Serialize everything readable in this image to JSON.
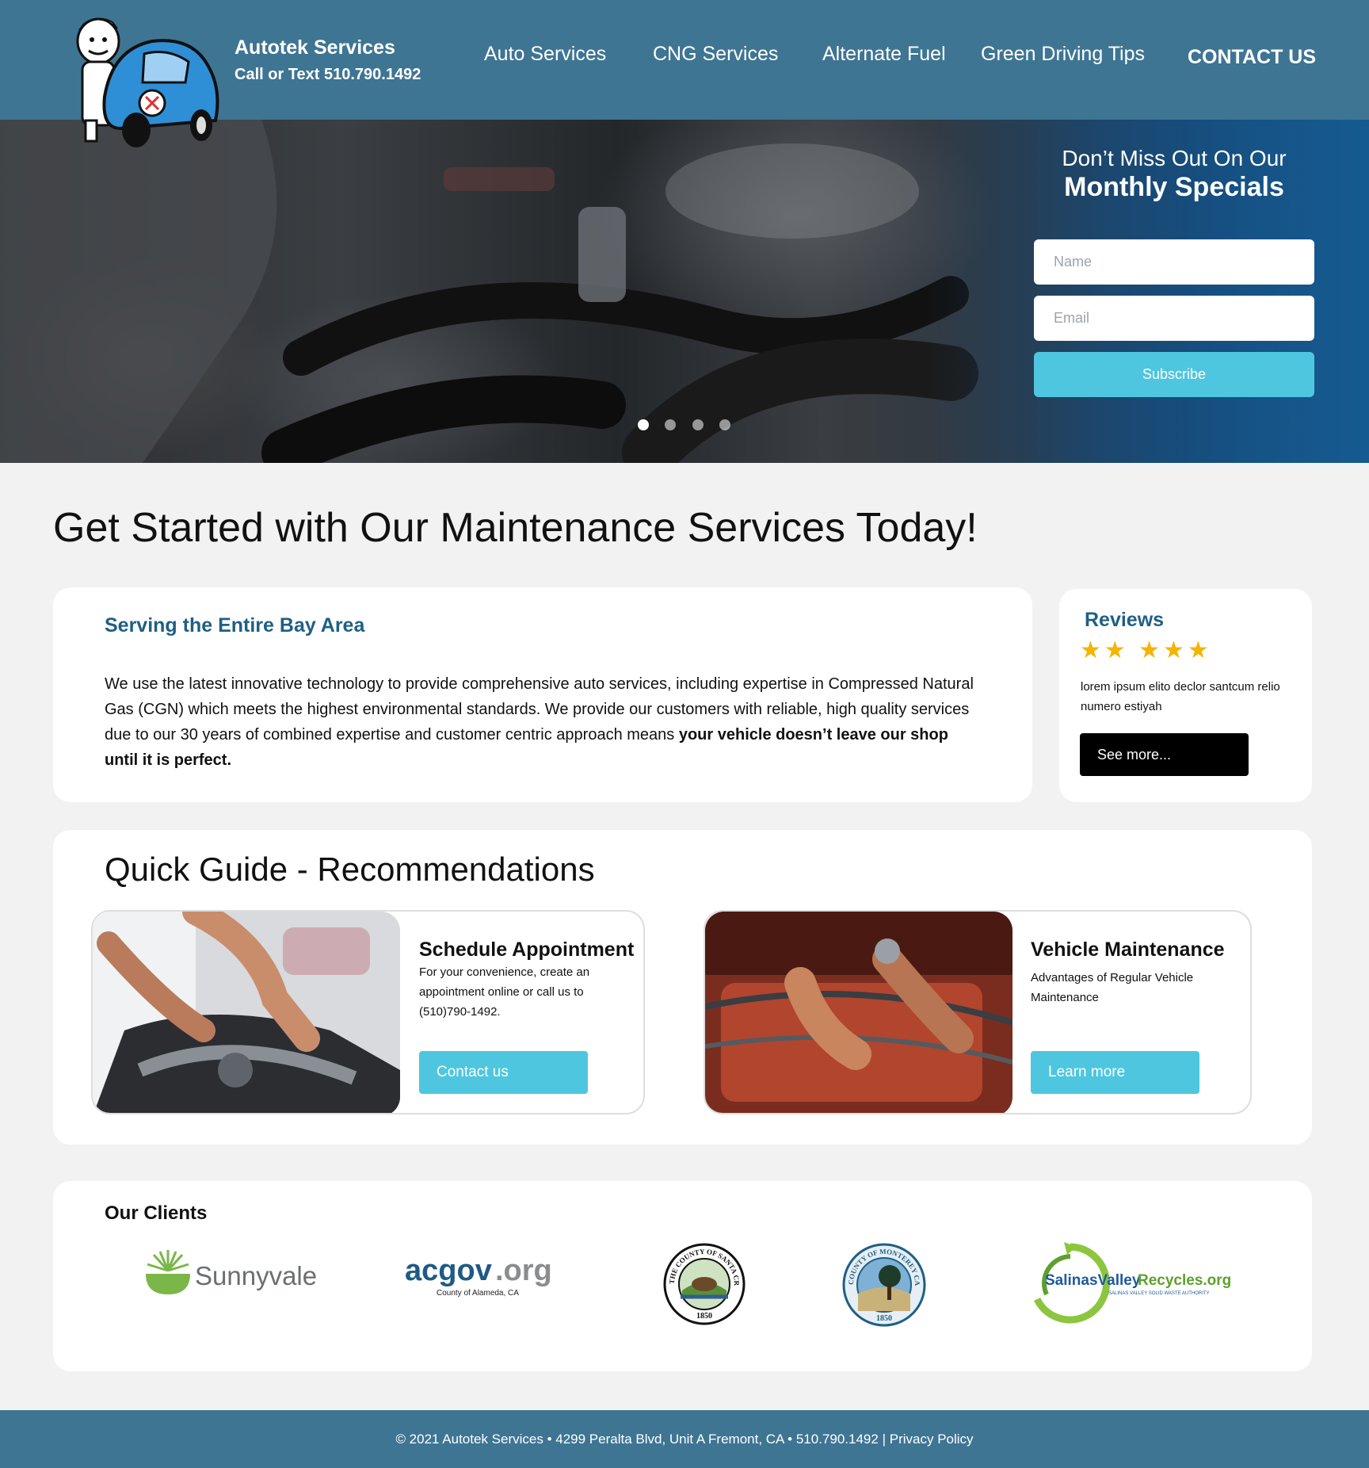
{
  "header": {
    "brand_name": "Autotek Services",
    "brand_phone": "Call or Text 510.790.1492",
    "nav": {
      "auto": "Auto Services",
      "cng": "CNG Services",
      "alt_fuel": "Alternate Fuel",
      "green": "Green Driving Tips",
      "contact": "CONTACT US"
    }
  },
  "hero": {
    "title_line1": "Don’t Miss Out On Our",
    "title_line2": "Monthly Specials",
    "name_placeholder": "Name",
    "email_placeholder": "Email",
    "subscribe_label": "Subscribe",
    "slides_total": 4,
    "active_slide": 1
  },
  "main": {
    "heading": "Get Started with Our Maintenance Services Today!"
  },
  "intro": {
    "title": "Serving the Entire Bay Area",
    "text": "We use the latest innovative technology to provide comprehensive auto services, including expertise in Compressed Natural Gas (CGN) which meets the highest environmental standards. We provide our customers with reliable, high quality services due to our 30 years of combined expertise and customer centric approach means ",
    "text_bold": "your vehicle doesn’t leave our shop until it is perfect."
  },
  "reviews": {
    "title": "Reviews",
    "stars": "★★ ★★★",
    "rating": 5,
    "text": "lorem ipsum elito declor santcum relio numero estiyah",
    "button": "See more..."
  },
  "guide": {
    "title": "Quick Guide - Recommendations",
    "cards": [
      {
        "heading": "Schedule Appointment",
        "text": "For your convenience, create an appointment online or call us to (510)790-1492.",
        "button": "Contact us"
      },
      {
        "heading": "Vehicle Maintenance",
        "text": "Advantages of Regular Vehicle Maintenance",
        "button": "Learn more"
      }
    ]
  },
  "clients": {
    "title": "Our Clients",
    "logos": {
      "sunnyvale": "Sunnyvale",
      "acgov_main": "acgov",
      "acgov_tld": ".org",
      "acgov_sub": "County of Alameda, CA",
      "santa_cruz": "THE COUNTY OF SANTA CRUZ",
      "santa_cruz_year": "1850",
      "monterey": "COUNTY OF MONTEREY CALIFORNIA",
      "monterey_year": "1850",
      "salinas_a": "SalinasValley",
      "salinas_b": "Recycles.org",
      "salinas_sub": "Salinas Valley Solid Waste Authority"
    }
  },
  "footer": {
    "copyright": "© 2021 Autotek Services  • 4299 Peralta Blvd, Unit A Fremont, CA • 510.790.1492",
    "separator": "|",
    "privacy": "Privacy Policy"
  },
  "colors": {
    "header_bg": "#3e7593",
    "accent": "#4fc6df",
    "title_blue": "#1f5f84",
    "star": "#f4b400"
  }
}
